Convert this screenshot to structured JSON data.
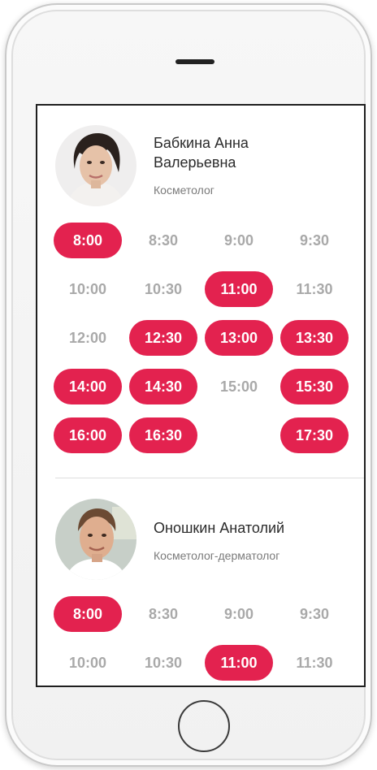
{
  "specialists": [
    {
      "name": "Бабкина Анна Валерьевна",
      "role": "Косметолог",
      "avatar_icon": "woman-portrait",
      "slots": [
        {
          "time": "8:00",
          "available": true
        },
        {
          "time": "8:30",
          "available": false
        },
        {
          "time": "9:00",
          "available": false
        },
        {
          "time": "9:30",
          "available": false
        },
        {
          "time": "10:00",
          "available": false
        },
        {
          "time": "10:30",
          "available": false
        },
        {
          "time": "11:00",
          "available": true
        },
        {
          "time": "11:30",
          "available": false
        },
        {
          "time": "12:00",
          "available": false
        },
        {
          "time": "12:30",
          "available": true
        },
        {
          "time": "13:00",
          "available": true
        },
        {
          "time": "13:30",
          "available": true
        },
        {
          "time": "14:00",
          "available": true
        },
        {
          "time": "14:30",
          "available": true
        },
        {
          "time": "15:00",
          "available": false
        },
        {
          "time": "15:30",
          "available": true
        },
        {
          "time": "16:00",
          "available": true
        },
        {
          "time": "16:30",
          "available": true
        },
        {
          "time": "",
          "available": false
        },
        {
          "time": "17:30",
          "available": true
        }
      ]
    },
    {
      "name": "Оношкин Анатолий",
      "role": "Косметолог-дерматолог",
      "avatar_icon": "man-portrait",
      "slots": [
        {
          "time": "8:00",
          "available": true
        },
        {
          "time": "8:30",
          "available": false
        },
        {
          "time": "9:00",
          "available": false
        },
        {
          "time": "9:30",
          "available": false
        },
        {
          "time": "10:00",
          "available": false
        },
        {
          "time": "10:30",
          "available": false
        },
        {
          "time": "11:00",
          "available": true
        },
        {
          "time": "11:30",
          "available": false
        }
      ]
    }
  ],
  "colors": {
    "accent": "#e3224f",
    "inactive_text": "#a9a9a9"
  }
}
